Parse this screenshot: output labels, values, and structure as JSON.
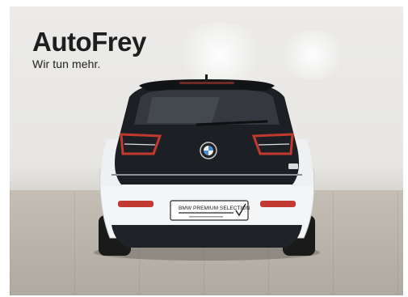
{
  "logo": {
    "name": "AutoFrey",
    "tagline": "Wir tun mehr."
  },
  "license_plate": {
    "text": "BMW PREMIUM SELECTION"
  },
  "colors": {
    "logo_text": "#1e1e1e",
    "car_body": "#f4f5f6",
    "car_glass": "#1c1f24",
    "tail_light": "#c23a2f"
  }
}
